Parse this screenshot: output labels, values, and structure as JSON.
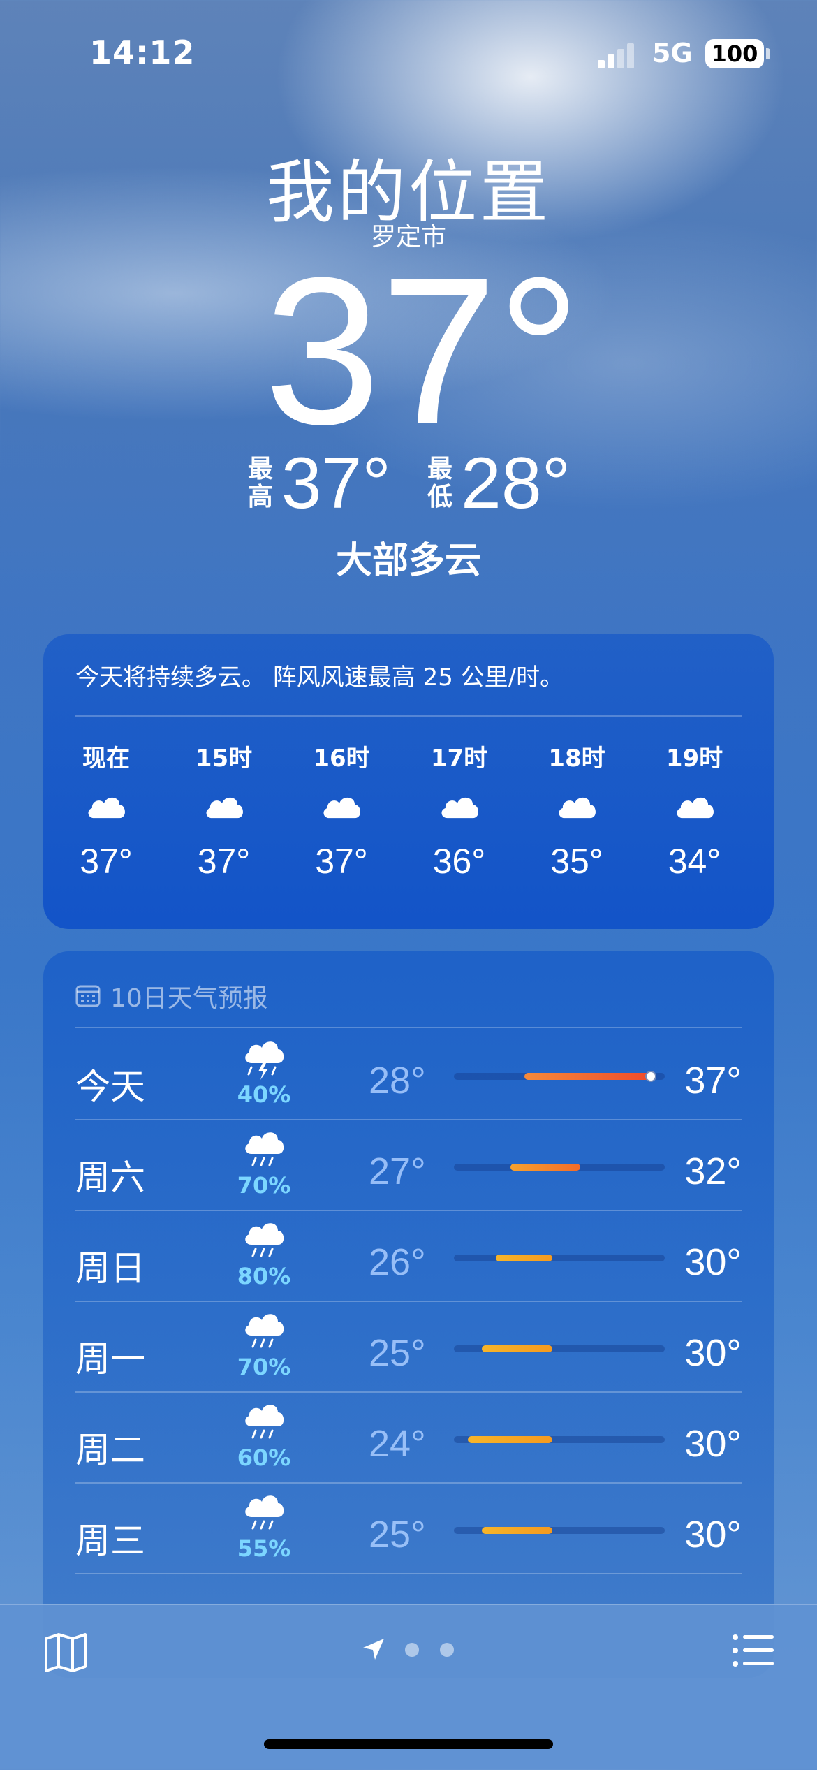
{
  "status_bar": {
    "time": "14:12",
    "network": "5G",
    "battery": "100"
  },
  "header": {
    "location": "我的位置",
    "city": "罗定市",
    "current_temp": "37°",
    "high_label_top": "最",
    "high_label_bottom": "高",
    "high": "37°",
    "low_label_top": "最",
    "low_label_bottom": "低",
    "low": "28°",
    "condition": "大部多云"
  },
  "hourly": {
    "summary": "今天将持续多云。 阵风风速最高 25 公里/时。",
    "hours": [
      {
        "time": "现在",
        "icon": "cloud-icon",
        "temp": "37°"
      },
      {
        "time": "15时",
        "icon": "cloud-icon",
        "temp": "37°"
      },
      {
        "time": "16时",
        "icon": "cloud-icon",
        "temp": "37°"
      },
      {
        "time": "17时",
        "icon": "cloud-icon",
        "temp": "36°"
      },
      {
        "time": "18时",
        "icon": "cloud-icon",
        "temp": "35°"
      },
      {
        "time": "19时",
        "icon": "cloud-icon",
        "temp": "34°"
      }
    ]
  },
  "daily": {
    "title": "10日天气预报",
    "title_icon": "calendar-icon",
    "days": [
      {
        "day": "今天",
        "icon": "thunderstorm-icon",
        "precip": "40%",
        "low": "28°",
        "high": "37°",
        "low_value": 28,
        "high_value": 37
      },
      {
        "day": "周六",
        "icon": "rain-icon",
        "precip": "70%",
        "low": "27°",
        "high": "32°",
        "low_value": 27,
        "high_value": 32
      },
      {
        "day": "周日",
        "icon": "rain-icon",
        "precip": "80%",
        "low": "26°",
        "high": "30°",
        "low_value": 26,
        "high_value": 30
      },
      {
        "day": "周一",
        "icon": "rain-icon",
        "precip": "70%",
        "low": "25°",
        "high": "30°",
        "low_value": 25,
        "high_value": 30
      },
      {
        "day": "周二",
        "icon": "rain-icon",
        "precip": "60%",
        "low": "24°",
        "high": "30°",
        "low_value": 24,
        "high_value": 30
      },
      {
        "day": "周三",
        "icon": "rain-icon",
        "precip": "55%",
        "low": "25°",
        "high": "30°",
        "low_value": 25,
        "high_value": 30
      }
    ],
    "range_min": 23,
    "range_max": 38,
    "current_temp_value": 37
  },
  "toolbar": {
    "map_icon": "map-icon",
    "location_icon": "location-arrow-icon",
    "list_icon": "list-icon",
    "page_count": 3
  }
}
